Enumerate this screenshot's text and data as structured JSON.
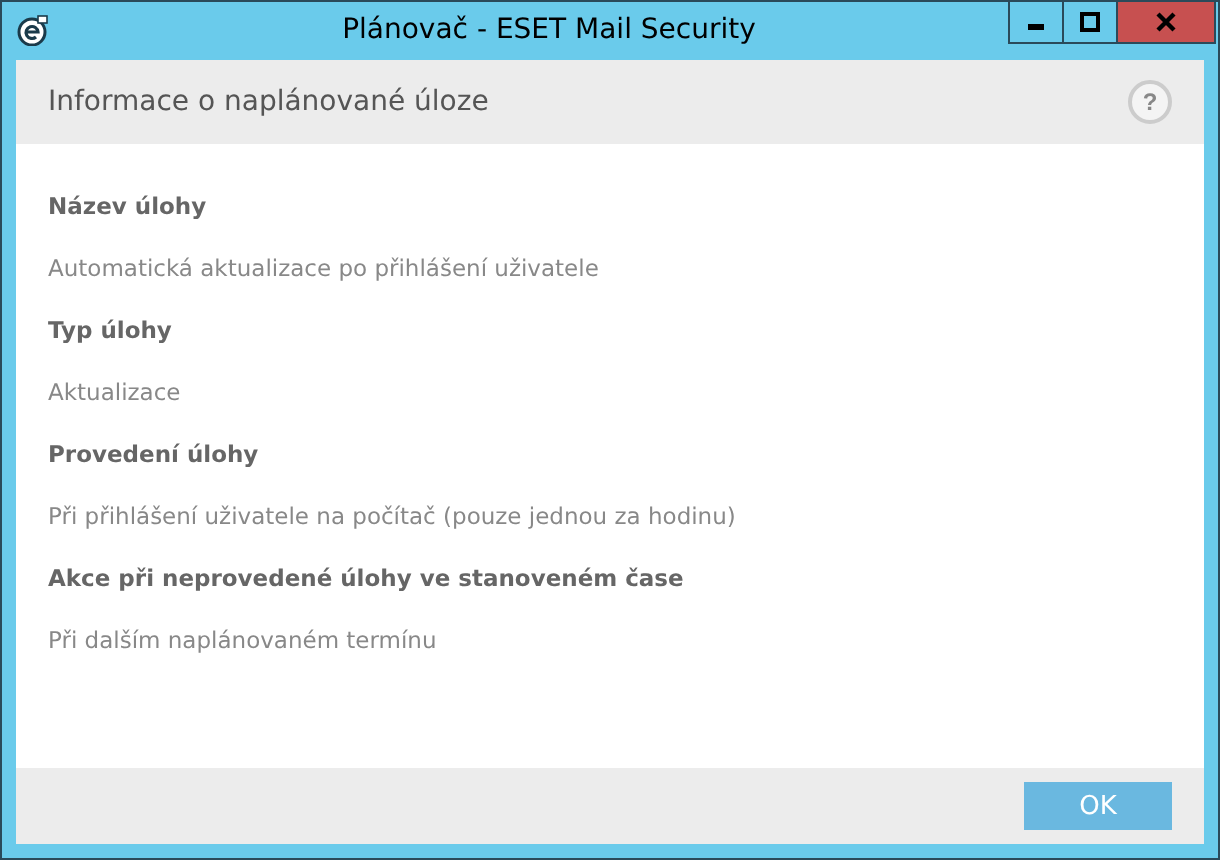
{
  "window": {
    "title": "Plánovač - ESET Mail Security"
  },
  "header": {
    "title": "Informace o naplánované úloze",
    "help": "?"
  },
  "fields": [
    {
      "label": "Název úlohy",
      "value": "Automatická aktualizace po přihlášení uživatele"
    },
    {
      "label": "Typ úlohy",
      "value": "Aktualizace"
    },
    {
      "label": "Provedení úlohy",
      "value": "Při přihlášení uživatele na počítač (pouze jednou za hodinu)"
    },
    {
      "label": "Akce při neprovedené úlohy ve stanoveném čase",
      "value": "Při dalším naplánovaném termínu"
    }
  ],
  "buttons": [
    "OK"
  ]
}
